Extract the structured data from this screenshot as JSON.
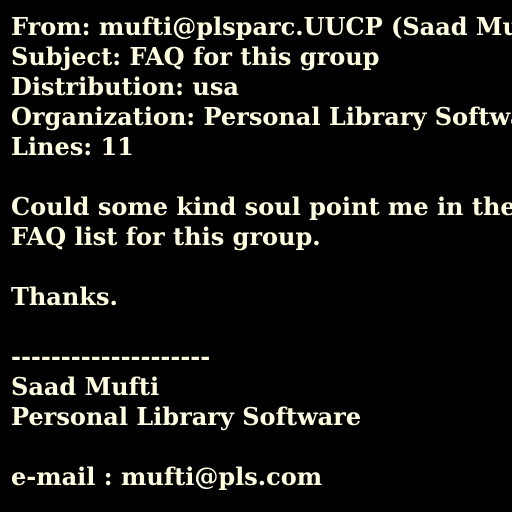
{
  "header": {
    "from": "From: mufti@plsparc.UUCP (Saad Mufti)",
    "subject": "Subject: FAQ for this group",
    "distribution": "Distribution: usa",
    "organization": "Organization: Personal Library Software",
    "lines": "Lines: 11"
  },
  "body": {
    "paragraph_line_1": "Could some kind soul point me in the right",
    "paragraph_line_2": "FAQ list for this group.",
    "thanks": "Thanks."
  },
  "signature": {
    "separator": "--------------------",
    "name": "Saad Mufti",
    "company": "Personal Library Software",
    "email": "e-mail : mufti@pls.com"
  }
}
